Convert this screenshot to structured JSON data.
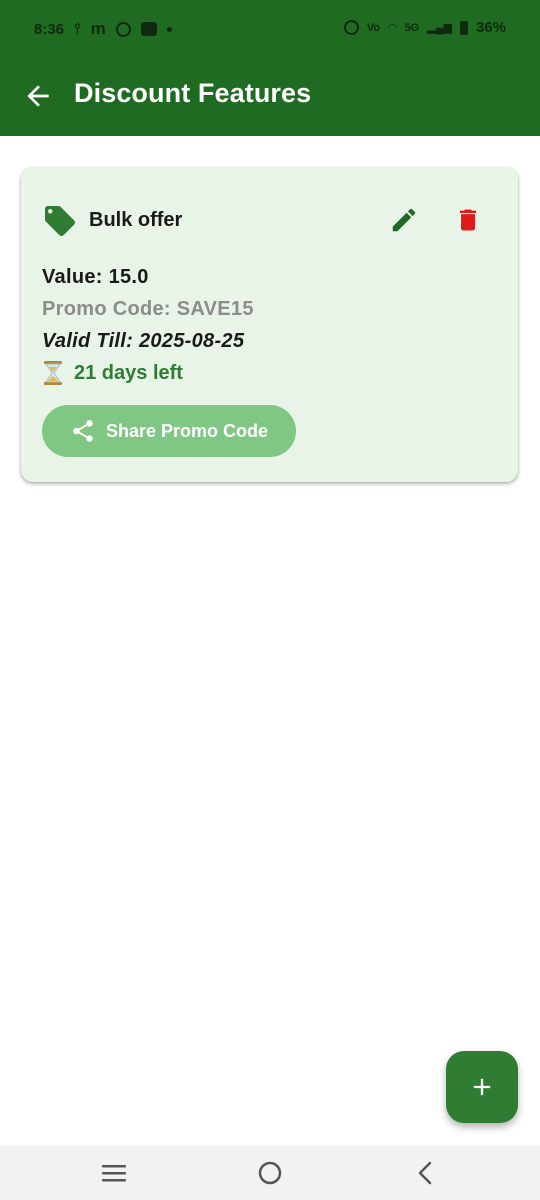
{
  "status_bar": {
    "time": "8:36",
    "left_icons": [
      "usb-icon",
      "m-app-icon",
      "whatsapp-icon",
      "message-icon",
      "dot-icon"
    ],
    "right_icons": [
      "alarm-icon",
      "volte-icon",
      "hotspot-icon",
      "5g-icon",
      "signal-icon",
      "battery-icon"
    ],
    "network": "5G",
    "battery": "36%"
  },
  "app_bar": {
    "title": "Discount Features",
    "back_icon": "arrow-left-icon",
    "background": "#1f6b21"
  },
  "discounts": [
    {
      "name": "Bulk offer",
      "value_label": "Value: 15.0",
      "promo_label": "Promo Code: SAVE15",
      "valid_label": "Valid Till: 2025-08-25",
      "days_left": "21 days left",
      "share_label": "Share Promo Code",
      "icons": {
        "tag": "tag-icon",
        "edit": "pencil-icon",
        "delete": "trash-icon",
        "share": "share-icon",
        "timer": "hourglass-icon"
      }
    }
  ],
  "colors": {
    "primary": "#1f6b21",
    "card_bg": "#e8f4e8",
    "accent_green": "#2e7d32",
    "delete_red": "#e01b1b",
    "share_button": "#81c784"
  },
  "fab": {
    "icon": "plus-icon"
  },
  "nav_bar": {
    "icons": [
      "menu-icon",
      "home-circle-icon",
      "back-chevron-icon"
    ]
  }
}
